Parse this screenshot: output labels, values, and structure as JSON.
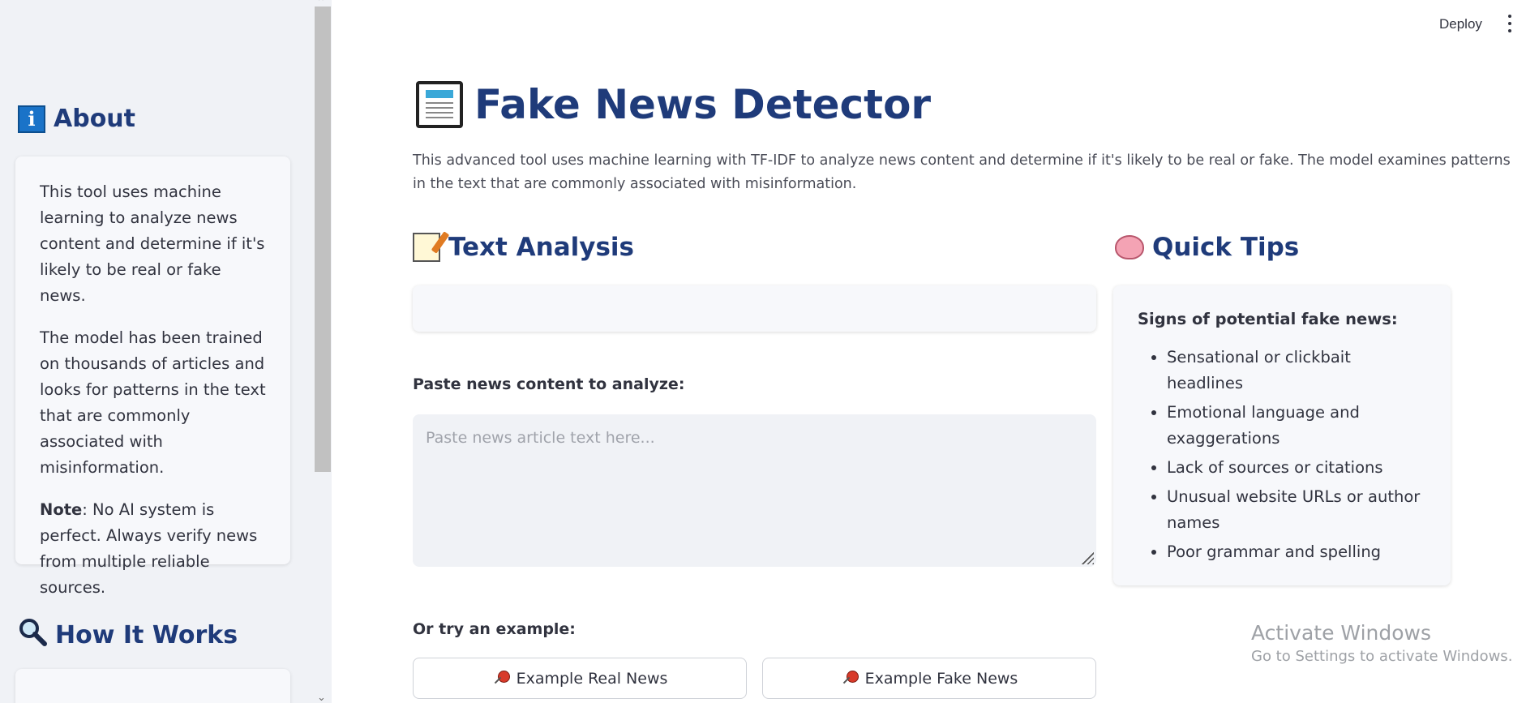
{
  "topbar": {
    "deploy_label": "Deploy",
    "menu_icon": "kebab-menu-icon"
  },
  "sidebar": {
    "about": {
      "icon": "info-icon",
      "title": "About",
      "p1": "This tool uses machine learning to analyze news content and determine if it's likely to be real or fake news.",
      "p2": "The model has been trained on thousands of articles and looks for patterns in the text that are commonly associated with misinformation.",
      "note_label": "Note",
      "note_text": ": No AI system is perfect. Always verify news from multiple reliable sources."
    },
    "how": {
      "icon": "magnifier-icon",
      "title": "How It Works"
    }
  },
  "main": {
    "title": "Fake News Detector",
    "title_icon": "newspaper-icon",
    "intro": "This advanced tool uses machine learning with TF-IDF to analyze news content and determine if it's likely to be real or fake. The model examines patterns in the text that are commonly associated with misinformation.",
    "text_analysis": {
      "icon": "memo-icon",
      "title": "Text Analysis",
      "input_label": "Paste news content to analyze:",
      "placeholder": "Paste news article text here...",
      "example_label": "Or try an example:",
      "btn_real": "Example Real News",
      "btn_fake": "Example Fake News"
    },
    "quick_tips": {
      "icon": "brain-icon",
      "title": "Quick Tips",
      "heading": "Signs of potential fake news:",
      "items": [
        "Sensational or clickbait headlines",
        "Emotional language and exaggerations",
        "Lack of sources or citations",
        "Unusual website URLs or author names",
        "Poor grammar and spelling"
      ]
    }
  },
  "watermark": {
    "line1": "Activate Windows",
    "line2": "Go to Settings to activate Windows."
  }
}
